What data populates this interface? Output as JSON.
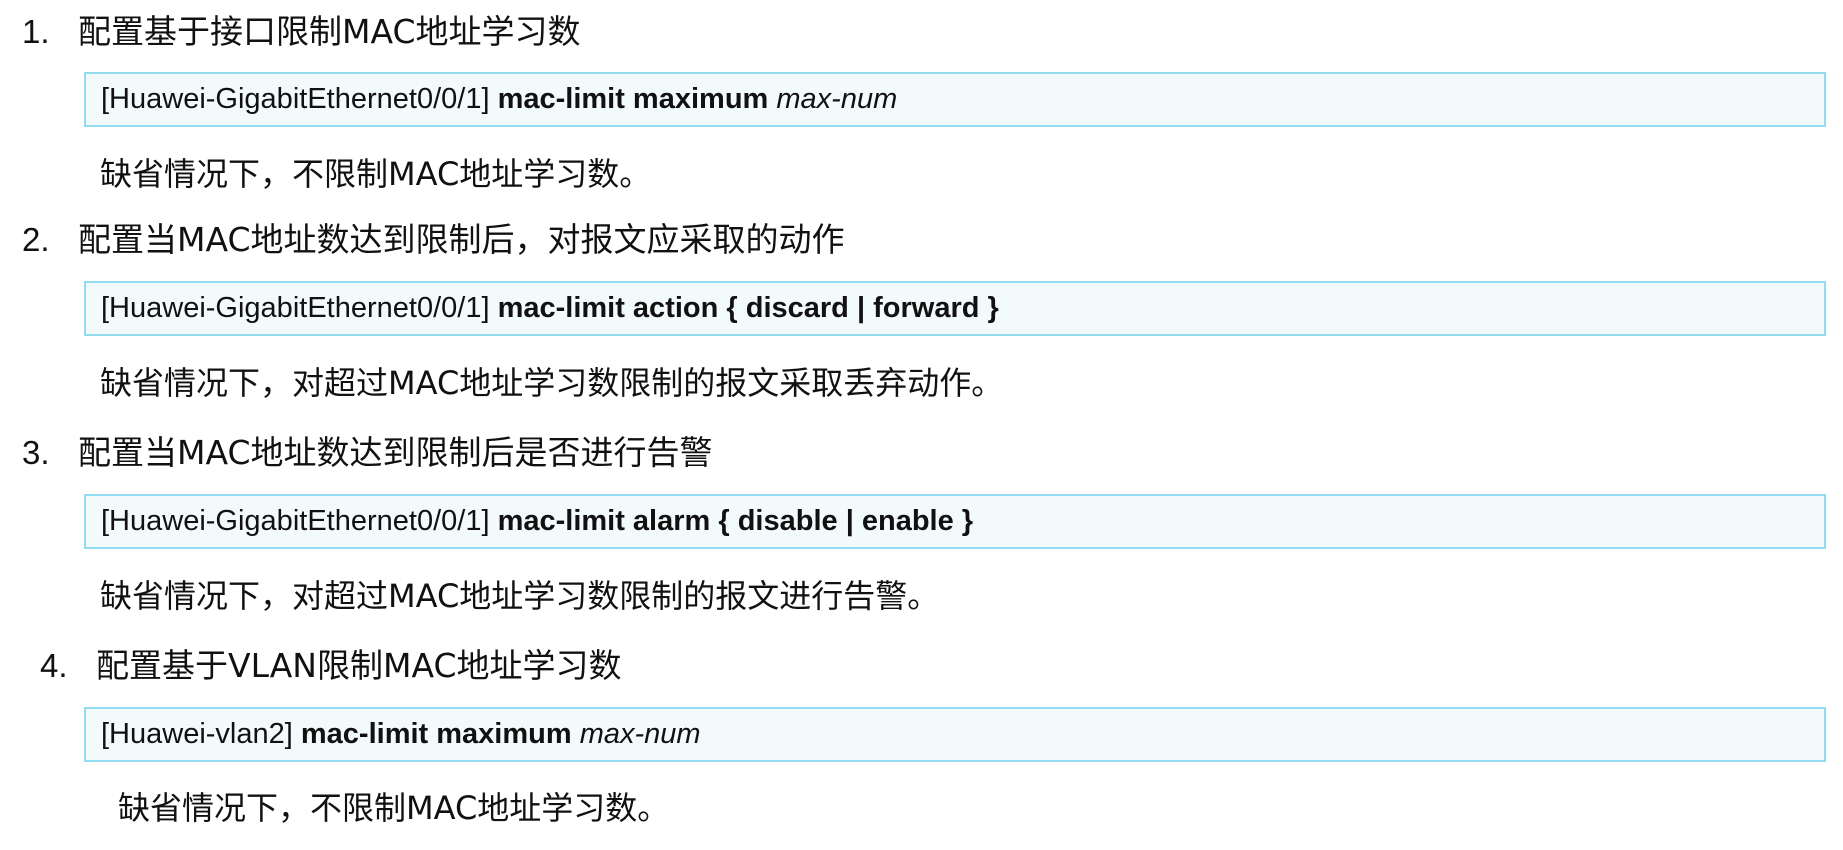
{
  "sections": [
    {
      "number": "1.",
      "title": "配置基于接口限制MAC地址学习数",
      "command": {
        "prompt": "[Huawei-GigabitEthernet0/0/1]",
        "keywords": "mac-limit maximum",
        "argument": "max-num"
      },
      "note": "缺省情况下，不限制MAC地址学习数。"
    },
    {
      "number": "2.",
      "title": "配置当MAC地址数达到限制后，对报文应采取的动作",
      "command": {
        "prompt": "[Huawei-GigabitEthernet0/0/1]",
        "keywords": "mac-limit action { discard | forward }",
        "argument": ""
      },
      "note": "缺省情况下，对超过MAC地址学习数限制的报文采取丢弃动作。"
    },
    {
      "number": "3.",
      "title": "配置当MAC地址数达到限制后是否进行告警",
      "command": {
        "prompt": "[Huawei-GigabitEthernet0/0/1]",
        "keywords": "mac-limit alarm { disable | enable }",
        "argument": ""
      },
      "note": "缺省情况下，对超过MAC地址学习数限制的报文进行告警。"
    },
    {
      "number": "4.",
      "title": "配置基于VLAN限制MAC地址学习数",
      "command": {
        "prompt": "[Huawei-vlan2]",
        "keywords": "mac-limit maximum",
        "argument": "max-num"
      },
      "note": "缺省情况下，不限制MAC地址学习数。"
    }
  ]
}
